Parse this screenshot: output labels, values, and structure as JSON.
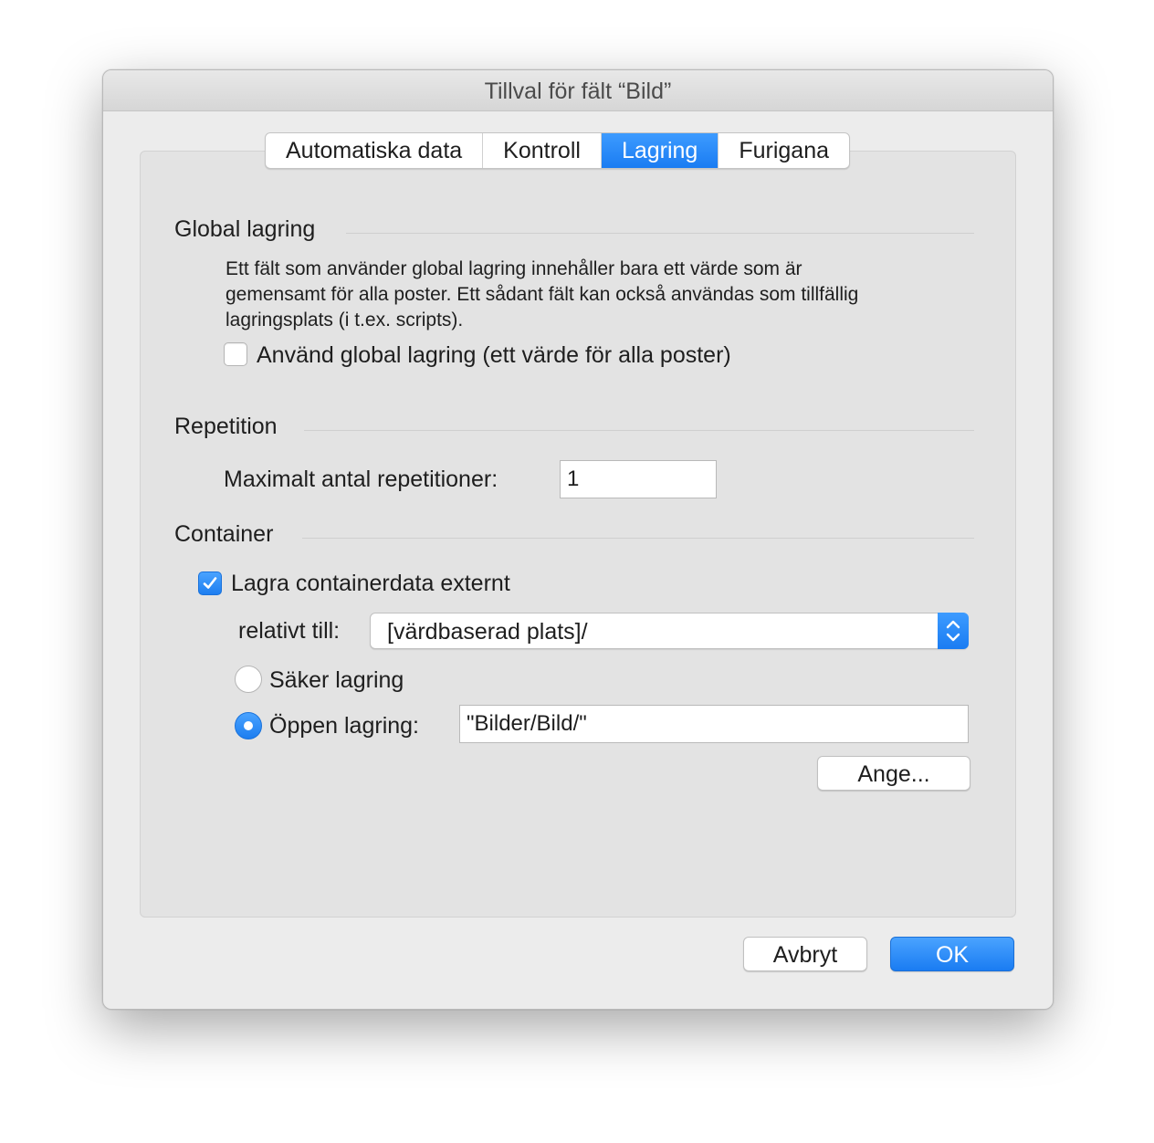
{
  "window": {
    "title": "Tillval för fält “Bild”"
  },
  "tabs": [
    {
      "label": "Automatiska data",
      "selected": false
    },
    {
      "label": "Kontroll",
      "selected": false
    },
    {
      "label": "Lagring",
      "selected": true
    },
    {
      "label": "Furigana",
      "selected": false
    }
  ],
  "global": {
    "title": "Global lagring",
    "description": "Ett fält som använder global lagring innehåller bara ett värde som är\ngemensamt för alla poster.  Ett sådant fält kan också användas som tillfällig\nlagringsplats (i t.ex. scripts).",
    "checkbox_label": "Använd global lagring (ett värde för alla poster)",
    "checked": false
  },
  "repetition": {
    "title": "Repetition",
    "max_label": "Maximalt antal repetitioner:",
    "max_value": "1"
  },
  "container": {
    "title": "Container",
    "external_label": "Lagra containerdata externt",
    "external_checked": true,
    "relative_label": "relativt till:",
    "relative_value": "[värdbaserad plats]/",
    "secure_label": "Säker lagring",
    "open_label": "Öppen lagring:",
    "open_value": "\"Bilder/Bild/\"",
    "selected_storage": "open",
    "set_button": "Ange..."
  },
  "footer": {
    "cancel_label": "Avbryt",
    "ok_label": "OK"
  },
  "colors": {
    "accent": "#1a7cf2",
    "window_bg": "#ececec",
    "panel_bg": "#e3e3e3"
  }
}
